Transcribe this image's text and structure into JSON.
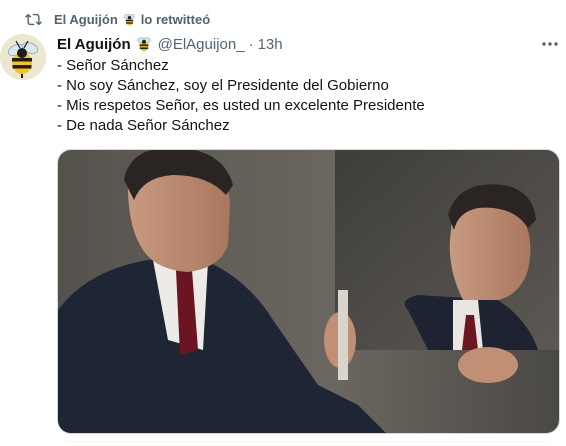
{
  "retweet": {
    "icon": "retweet-icon",
    "user": "El Aguijón",
    "emoji_icon": "bee-icon",
    "suffix": "lo retwitteó"
  },
  "tweet": {
    "avatar_icon": "bee-avatar-icon",
    "author_name": "El Aguijón",
    "author_emoji_icon": "bee-icon",
    "handle": "@ElAguijon_",
    "separator": "·",
    "time": "13h",
    "more_icon": "more-icon",
    "lines": [
      "- Señor Sánchez",
      "- No soy Sánchez, soy el Presidente del Gobierno",
      "- Mis respetos Señor, es usted un excelente Presidente",
      "- De nada Señor Sánchez"
    ],
    "media_icon": "photo-man-holding-mirror"
  },
  "colors": {
    "text": "#0f1419",
    "secondary": "#536471",
    "border": "#cfd9de",
    "background": "#ffffff"
  }
}
